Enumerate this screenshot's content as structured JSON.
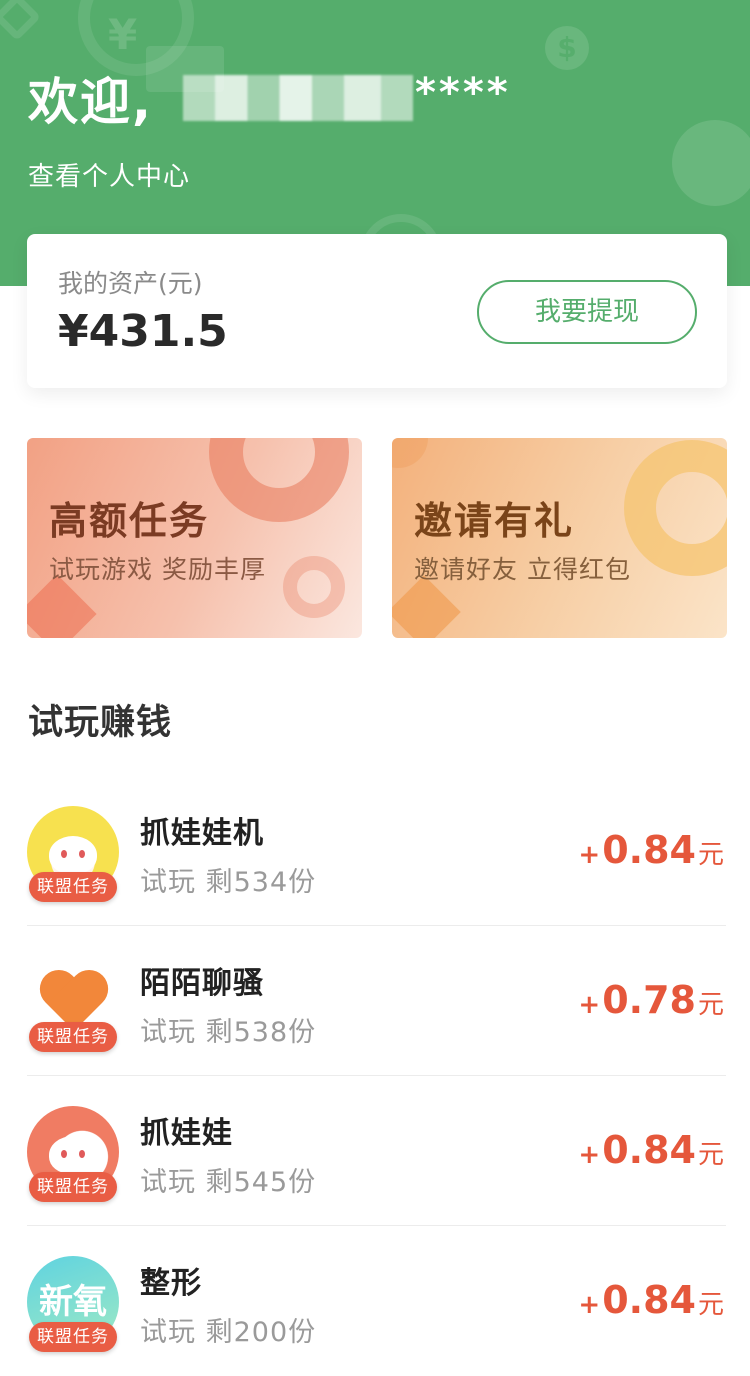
{
  "header": {
    "greeting": "欢迎,",
    "username_visible": "****",
    "profile_link": "查看个人中心",
    "colors": {
      "header_bg": "#55ad6c"
    }
  },
  "asset": {
    "label": "我的资产(元)",
    "value": "¥431.5",
    "withdraw_button": "我要提现"
  },
  "promos": [
    {
      "title": "高额任务",
      "subtitle": "试玩游戏 奖励丰厚"
    },
    {
      "title": "邀请有礼",
      "subtitle": "邀请好友 立得红包"
    }
  ],
  "section": {
    "title": "试玩赚钱"
  },
  "tasks": [
    {
      "name": "抓娃娃机",
      "desc": "试玩 剩534份",
      "badge": "联盟任务",
      "plus": "+",
      "amount": "0.84",
      "unit": "元",
      "icon": "claw-machine-cat-icon"
    },
    {
      "name": "陌陌聊骚",
      "desc": "试玩 剩538份",
      "badge": "联盟任务",
      "plus": "+",
      "amount": "0.78",
      "unit": "元",
      "icon": "orange-heart-icon"
    },
    {
      "name": "抓娃娃",
      "desc": "试玩 剩545份",
      "badge": "联盟任务",
      "plus": "+",
      "amount": "0.84",
      "unit": "元",
      "icon": "cat-face-icon"
    },
    {
      "name": "整形",
      "desc": "试玩 剩200份",
      "badge": "联盟任务",
      "plus": "+",
      "amount": "0.84",
      "unit": "元",
      "icon": "xinyang-logo-icon",
      "icon_text": "新氧"
    }
  ],
  "colors": {
    "accent_green": "#55ad6c",
    "reward_red": "#e5573b",
    "badge_red": "#e95d44"
  }
}
